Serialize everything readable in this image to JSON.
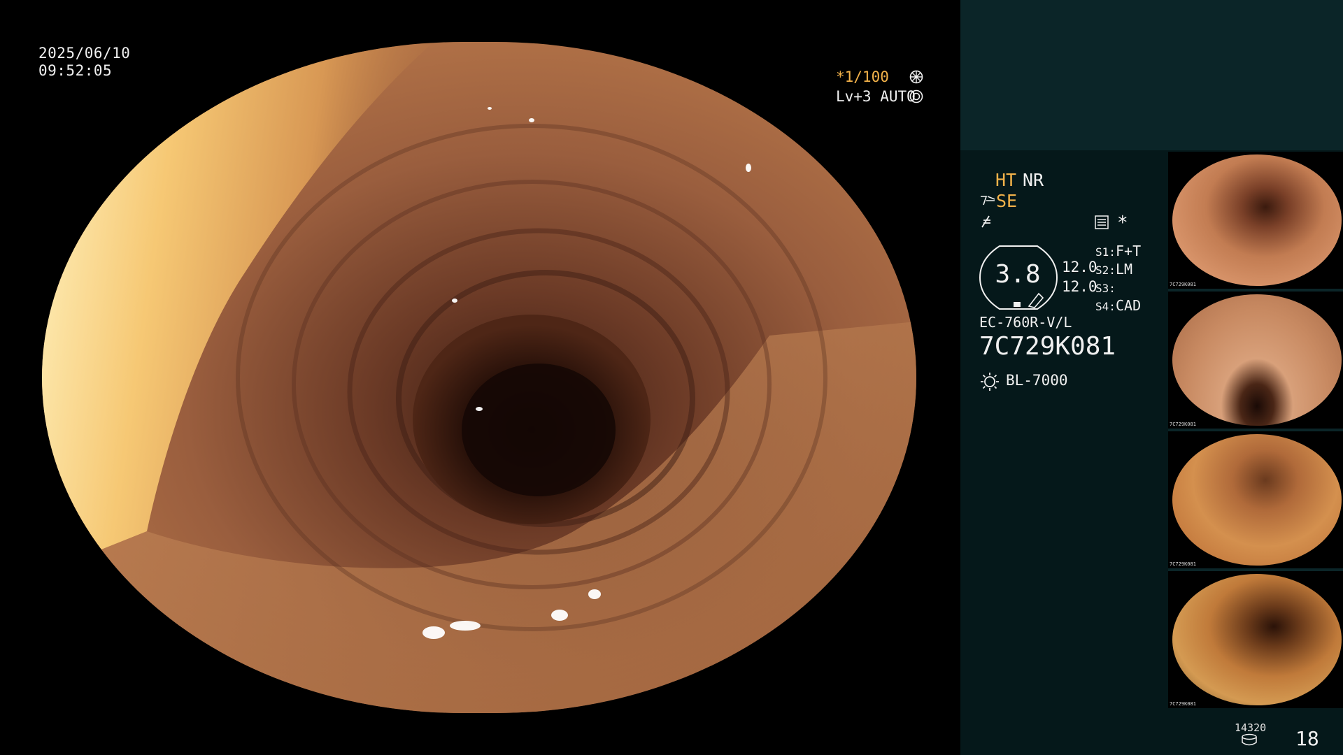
{
  "overlay": {
    "date": "2025/06/10",
    "time": "09:52:05",
    "shutter": "*1/100",
    "level": "Lv+3 AUTO"
  },
  "panel": {
    "ht": "HT",
    "nr": "NR",
    "se": "SE",
    "star": "*",
    "gauge_value": "3.8",
    "value1": "12.0",
    "value2": "12.0",
    "slots": [
      {
        "label": "S1:",
        "value": "F+T"
      },
      {
        "label": "S2:",
        "value": "LM"
      },
      {
        "label": "S3:",
        "value": ""
      },
      {
        "label": "S4:",
        "value": "CAD"
      }
    ],
    "scope_model": "EC-760R-V/L",
    "scope_serial": "7C729K081",
    "light_source": "BL-7000",
    "capture_count_small": "14320",
    "capture_count": "18"
  },
  "thumbnails": [
    {
      "caption": "7C729K081"
    },
    {
      "caption": "7C729K081"
    },
    {
      "caption": "7C729K081"
    },
    {
      "caption": "7C729K081"
    }
  ],
  "colors": {
    "accent_yellow": "#f3b24a",
    "panel_bg": "#05181a",
    "panel_top_bg": "#0b2528"
  },
  "icons": [
    "shutter-wheel-icon",
    "auto-ring-icon",
    "structure-enhance-icon",
    "f-slash-icon",
    "menu-list-icon",
    "light-source-icon",
    "disk-icon"
  ]
}
